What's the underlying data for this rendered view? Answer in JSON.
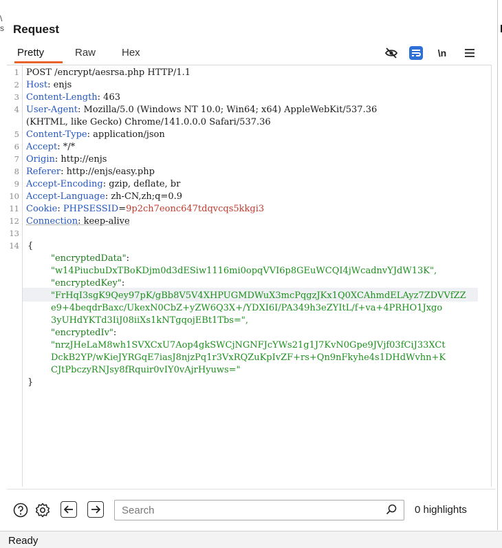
{
  "panel": {
    "title": "Request",
    "right_letter": "I",
    "left_edge": [
      "\\",
      "s"
    ]
  },
  "tabs": [
    {
      "label": "Pretty",
      "active": true
    },
    {
      "label": "Raw",
      "active": false
    },
    {
      "label": "Hex",
      "active": false
    }
  ],
  "toolbar": {
    "icons": [
      "eye-slash-icon",
      "wrap-lines-icon",
      "newline-toggle-icon",
      "menu-icon"
    ],
    "newline_label": "\\n",
    "accent_color": "#e8632b",
    "active_icon_color": "#2f6fd8"
  },
  "editor": {
    "line_numbers": [
      "1",
      "2",
      "3",
      "4",
      "5",
      "6",
      "7",
      "8",
      "9",
      "10",
      "11",
      "12",
      "13",
      "14"
    ],
    "lines": {
      "l1": "POST /encrypt/aesrsa.php HTTP/1.1",
      "l2_name": "Host",
      "l2_value": ": enjs",
      "l3_name": "Content-Length",
      "l3_value": ": 463",
      "l4_name": "User-Agent",
      "l4_value": ": Mozilla/5.0 (Windows NT 10.0; Win64; x64) AppleWebKit/537.36",
      "l4_cont": "(KHTML, like Gecko) Chrome/141.0.0.0 Safari/537.36",
      "l5_name": "Content-Type",
      "l5_value": ": application/json",
      "l6_name": "Accept",
      "l6_value": ": */*",
      "l7_name": "Origin",
      "l7_value": ": http://enjs",
      "l8_name": "Referer",
      "l8_value": ": http://enjs/easy.php",
      "l9_name": "Accept-Encoding",
      "l9_value": ": gzip, deflate, br",
      "l10_name": "Accept-Language",
      "l10_value": ": zh-CN,zh;q=0.9",
      "l11_name": "Cookie",
      "l11_sep": ": ",
      "l11_ckname": "PHPSESSID",
      "l11_eq": "=",
      "l11_ckvalue": "9p2ch7eonc647tdqvcqs5kkgi3",
      "l12_name": "Connection",
      "l12_value": ": keep-alive",
      "l14_open": "{",
      "enc_data_key": "\"encryptedData\"",
      "colon": ":",
      "enc_data_val": "\"w14PiucbuDxTBoKDjm0d3dESiw1116mi0opqVVI6p8GEuWCQI4jWcadnvYJdW13K\",",
      "enc_key_key": "\"encryptedKey\"",
      "enc_key_val_1": "\"FrHqI3sgK9Qey97pK/gBb8V5V4XHPUGMDWuX3mcPqgzJKx1Q0XCAhmdELAyz7ZDVVfZZ",
      "enc_key_val_2": "e9+4beqdrBaxc/UkexN0CbZ+yZW6Q3X+/YDXI6I/PA349h3eZYItL/f+va+4PRHO1Jxgo",
      "enc_key_val_3": "3yUHdYKTd3IiJ08iiXs1kNTgqojEBt1Tbs=\",",
      "enc_iv_key": "\"encryptedIv\"",
      "enc_iv_val_1": "\"nrzJHeLaM8wh1SVXCxU7Aop4gkSWCjNGNFJcYWs21g1J7KvN0Gpe9JVjf03fCiJ33XCt",
      "enc_iv_val_2": "DckB2YP/wKieJYRGqE7iasJ8njzPq1r3VxRQZuKpIvZF+rs+Qn9nFkyhe4s1DHdWvhn+K",
      "enc_iv_val_3": "CJtPbczyRNJsy8fRquir0vIY0vAjrHyuws=\"",
      "close": "}"
    }
  },
  "bottom": {
    "search_placeholder": "Search",
    "highlights": "0 highlights"
  },
  "status": {
    "text": "Ready"
  }
}
